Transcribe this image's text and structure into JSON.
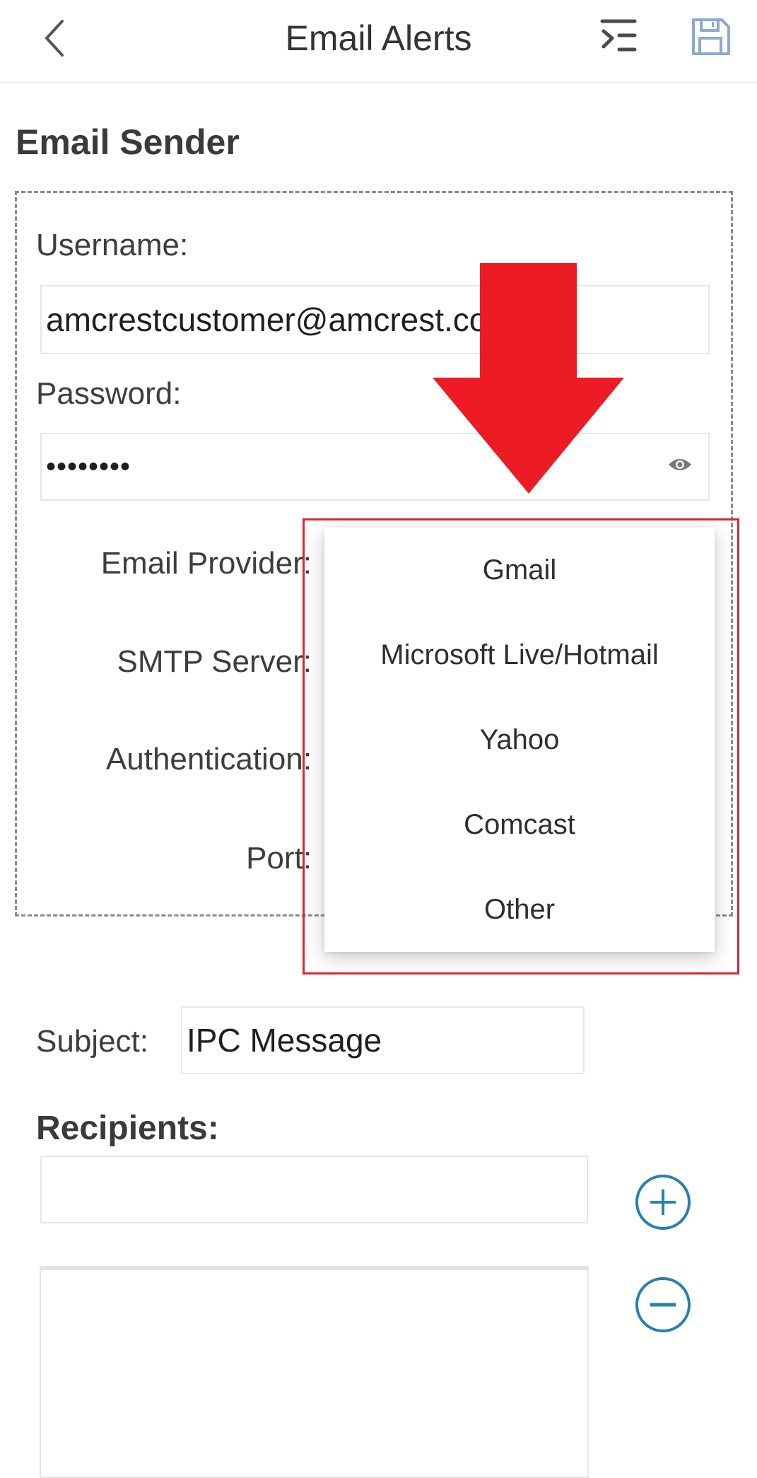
{
  "header": {
    "title": "Email Alerts",
    "back_icon": "chevron-left-icon",
    "menu_icon": "menu-collapse-icon",
    "save_icon": "floppy-disk-icon"
  },
  "sender": {
    "section_title": "Email Sender",
    "username_label": "Username:",
    "username_value": "amcrestcustomer@amcrest.com",
    "password_label": "Password:",
    "password_value": "••••••••",
    "show_password_icon": "eye-icon",
    "email_provider_label": "Email Provider:",
    "smtp_server_label": "SMTP Server:",
    "authentication_label": "Authentication:",
    "port_label": "Port:"
  },
  "provider_dropdown": {
    "options": [
      "Gmail",
      "Microsoft Live/Hotmail",
      "Yahoo",
      "Comcast",
      "Other"
    ]
  },
  "annotation": {
    "arrow_color": "#ED1C24",
    "highlight_color": "#D42A35"
  },
  "subject": {
    "label": "Subject:",
    "value": "IPC Message"
  },
  "recipients": {
    "label": "Recipients:",
    "input_value": "",
    "add_icon": "plus-circle-icon",
    "remove_icon": "minus-circle-icon"
  },
  "colors": {
    "accent_blue": "#2A7FAE",
    "save_icon_blue": "#8AAACE"
  }
}
